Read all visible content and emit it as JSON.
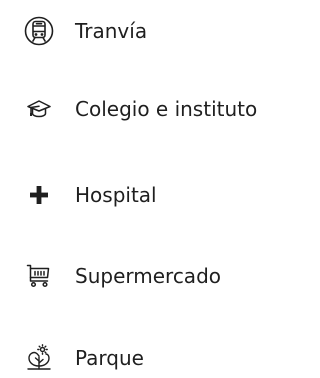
{
  "poi_categories": [
    {
      "label": "Tranvía",
      "icon": "tram-icon"
    },
    {
      "label": "Colegio e instituto",
      "icon": "graduation-cap-icon"
    },
    {
      "label": "Hospital",
      "icon": "medical-cross-icon"
    },
    {
      "label": "Supermercado",
      "icon": "shopping-cart-icon"
    },
    {
      "label": "Parque",
      "icon": "park-tree-sun-icon"
    }
  ],
  "colors": {
    "text": "#1f1f1f",
    "icon": "#1f1f1f",
    "background": "#ffffff"
  }
}
